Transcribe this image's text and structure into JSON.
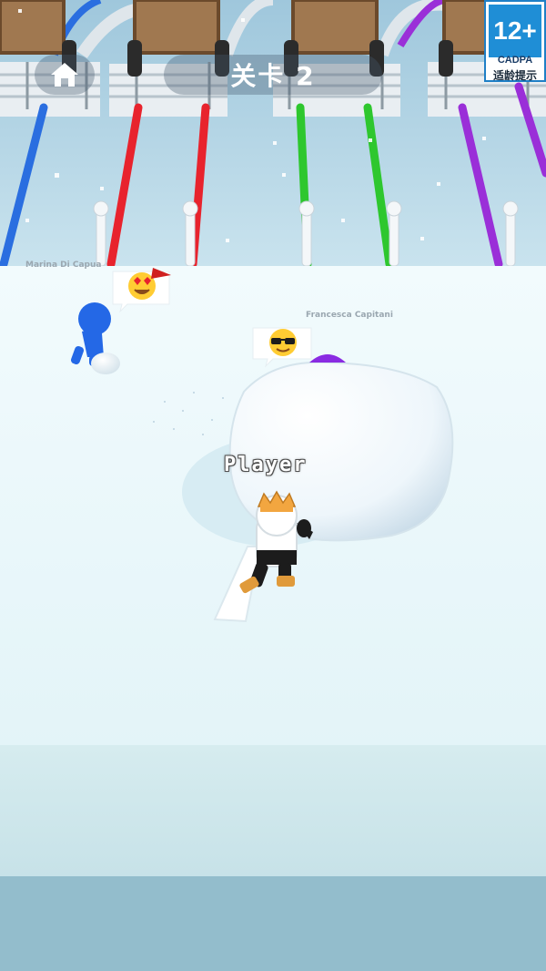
{
  "hud": {
    "home_icon": "home-icon",
    "level_label": "关卡 2"
  },
  "age_rating": {
    "rating": "12+",
    "org": "CADPA",
    "hint": "适龄提示"
  },
  "opponents": [
    {
      "name": "Marina Di Capua",
      "emoji": "heart-eyes",
      "color": "#2468e6"
    },
    {
      "name": "Francesca Capitani",
      "emoji": "sunglasses",
      "color": "#8a2be2"
    }
  ],
  "player": {
    "name": "Player"
  },
  "lanes": [
    {
      "color": "#2a6ee0"
    },
    {
      "color": "#e8232d"
    },
    {
      "color": "#2ec72e"
    },
    {
      "color": "#9a2fd8"
    }
  ]
}
